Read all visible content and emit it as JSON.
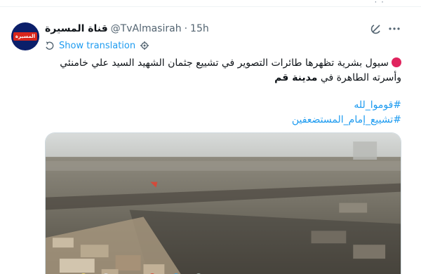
{
  "account": {
    "display_name": "قناة المسيرة",
    "handle": "@TvAlmasirah",
    "separator": "·",
    "time": "15h",
    "avatar_text": "المسيرة"
  },
  "translate": {
    "label": "Show translation"
  },
  "tweet": {
    "line1": "سيول بشرية تظهرها طائرات التصوير في تشييع جثمان الشهيد السيد علي خامنئي",
    "line2_prefix": "وأسرته الطاهرة في",
    "line2_bold": "مدينة قم",
    "hashtags": [
      "#قوموا_لله",
      "#تشييع_إمام_المستضعفين"
    ]
  },
  "colors": {
    "link": "#1d9bf0",
    "red_dot": "#e0245e",
    "avatar_bg": "#0b1f6a"
  },
  "icons": {
    "grok": "grok-icon",
    "more": "more-icon",
    "translate": "translate-icon",
    "settings": "gear-icon"
  }
}
